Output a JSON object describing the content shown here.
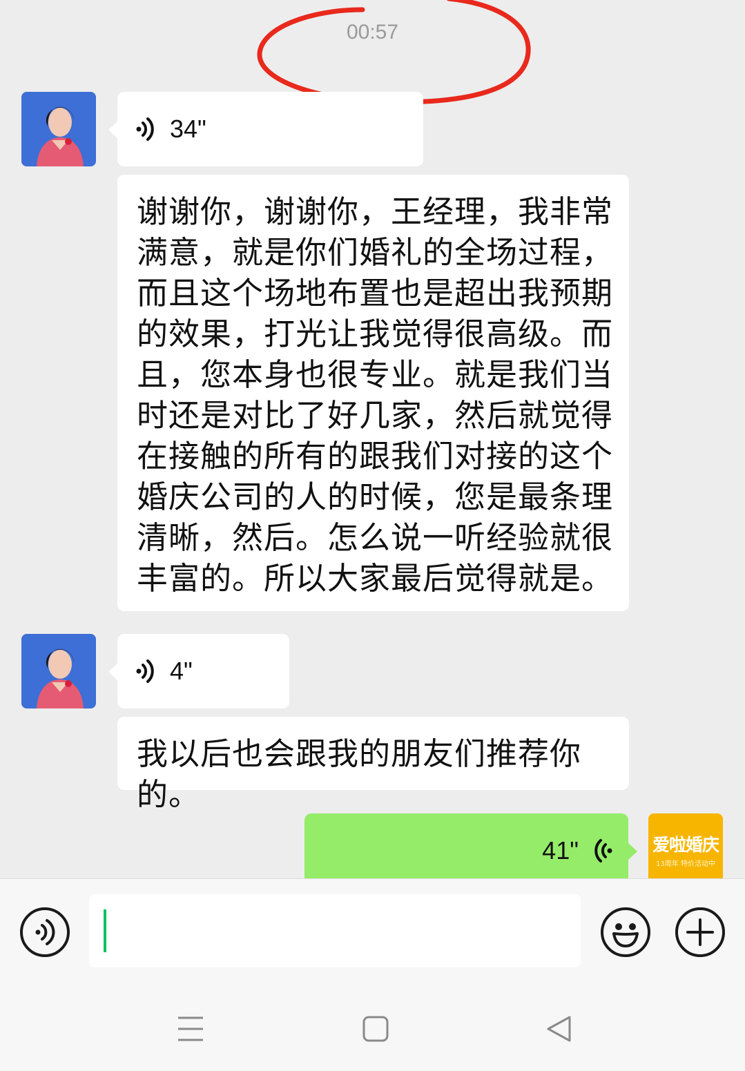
{
  "chat": {
    "timestamp": "00:57",
    "messages": [
      {
        "sender": "contact",
        "type": "voice",
        "duration": "34\""
      },
      {
        "sender": "contact",
        "type": "transcript",
        "lines": [
          "谢谢你，谢谢你，王经理，我非常",
          "满意，就是你们婚礼的全场过程，",
          "而且这个场地布置也是超出我预期",
          "的效果，打光让我觉得很高级。而",
          "且，您本身也很专业。就是我们当",
          "时还是对比了好几家，然后就觉得",
          "在接触的所有的跟我们对接的这个",
          "婚庆公司的人的时候，您是最条理",
          "清晰，然后。怎么说一听经验就很",
          "丰富的。所以大家最后觉得就是。"
        ]
      },
      {
        "sender": "contact",
        "type": "voice",
        "duration": "4\""
      },
      {
        "sender": "contact",
        "type": "transcript",
        "lines": [
          "我以后也会跟我的朋友们推荐你的。"
        ]
      },
      {
        "sender": "self",
        "type": "voice",
        "duration": "41\""
      }
    ],
    "self_avatar": {
      "brand": "爱啦婚庆",
      "sub": "13周年 特价活动中"
    }
  },
  "input_bar": {
    "voice_button_icon": "voice-mode-icon",
    "input_value": "",
    "emoji_button_icon": "emoji-icon",
    "plus_button_icon": "plus-icon"
  },
  "nav_bar": {
    "menu_icon": "menu-icon",
    "home_icon": "home-square-icon",
    "back_icon": "back-triangle-icon"
  },
  "colors": {
    "background": "#ededed",
    "incoming_bubble": "#ffffff",
    "outgoing_bubble": "#95ec69",
    "caret": "#07c160",
    "annotation": "#e8291c"
  }
}
